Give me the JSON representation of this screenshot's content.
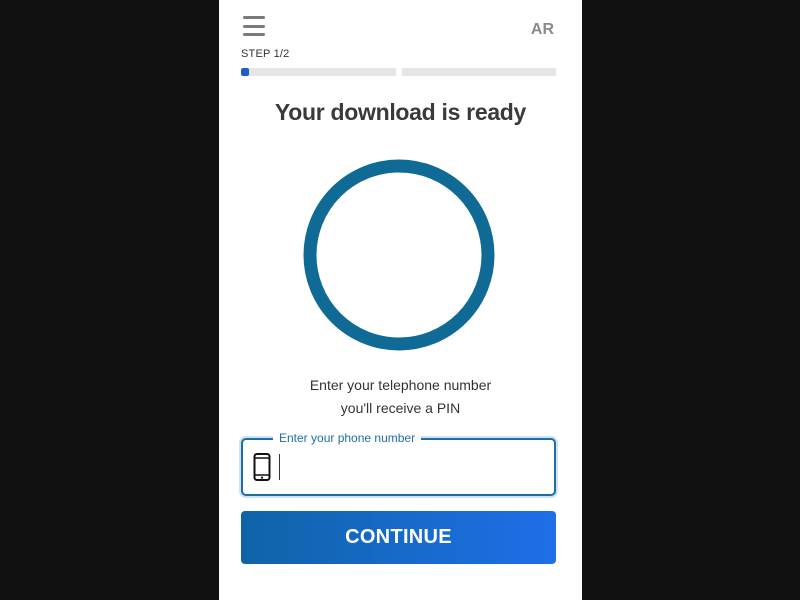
{
  "header": {
    "menu_icon": "hamburger-menu-icon",
    "language": "AR"
  },
  "progress": {
    "label": "STEP 1/2",
    "step_1_fill": 0.05,
    "step_2_fill": 0,
    "fill_color": "#1f5fbf"
  },
  "main": {
    "title": "Your download is ready",
    "ring_color": "#0f6a96",
    "instruction_line1": "Enter your telephone number",
    "instruction_line2": "you'll receive a PIN"
  },
  "phone_field": {
    "legend": "Enter your phone number",
    "icon": "mobile-phone-icon",
    "value": "",
    "accent": "#1e6ea0"
  },
  "continue_button": {
    "label": "CONTINUE"
  }
}
